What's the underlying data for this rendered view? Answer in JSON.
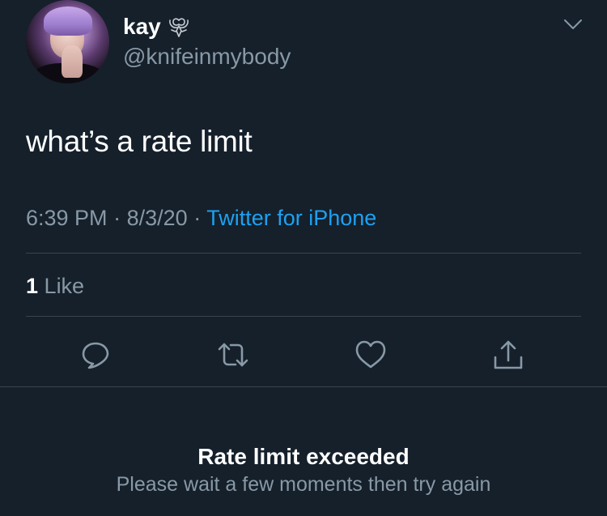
{
  "tweet": {
    "display_name": "kay",
    "handle": "@knifeinmybody",
    "text": "what’s a rate limit",
    "time": "6:39 PM",
    "separator": "·",
    "date": "8/3/20",
    "source": "Twitter for iPhone",
    "likes_count": "1",
    "likes_label": "Like",
    "badge_icon": "floral-emblem-icon",
    "menu_icon": "chevron-down-icon"
  },
  "actions": [
    {
      "icon": "reply-icon"
    },
    {
      "icon": "retweet-icon"
    },
    {
      "icon": "heart-icon"
    },
    {
      "icon": "share-icon"
    }
  ],
  "error": {
    "title": "Rate limit exceeded",
    "subtitle": "Please wait a few moments then try again"
  },
  "colors": {
    "background": "#15202b",
    "text_primary": "#ffffff",
    "text_secondary": "#8899a6",
    "link": "#1da1f2",
    "divider": "#38444d"
  }
}
